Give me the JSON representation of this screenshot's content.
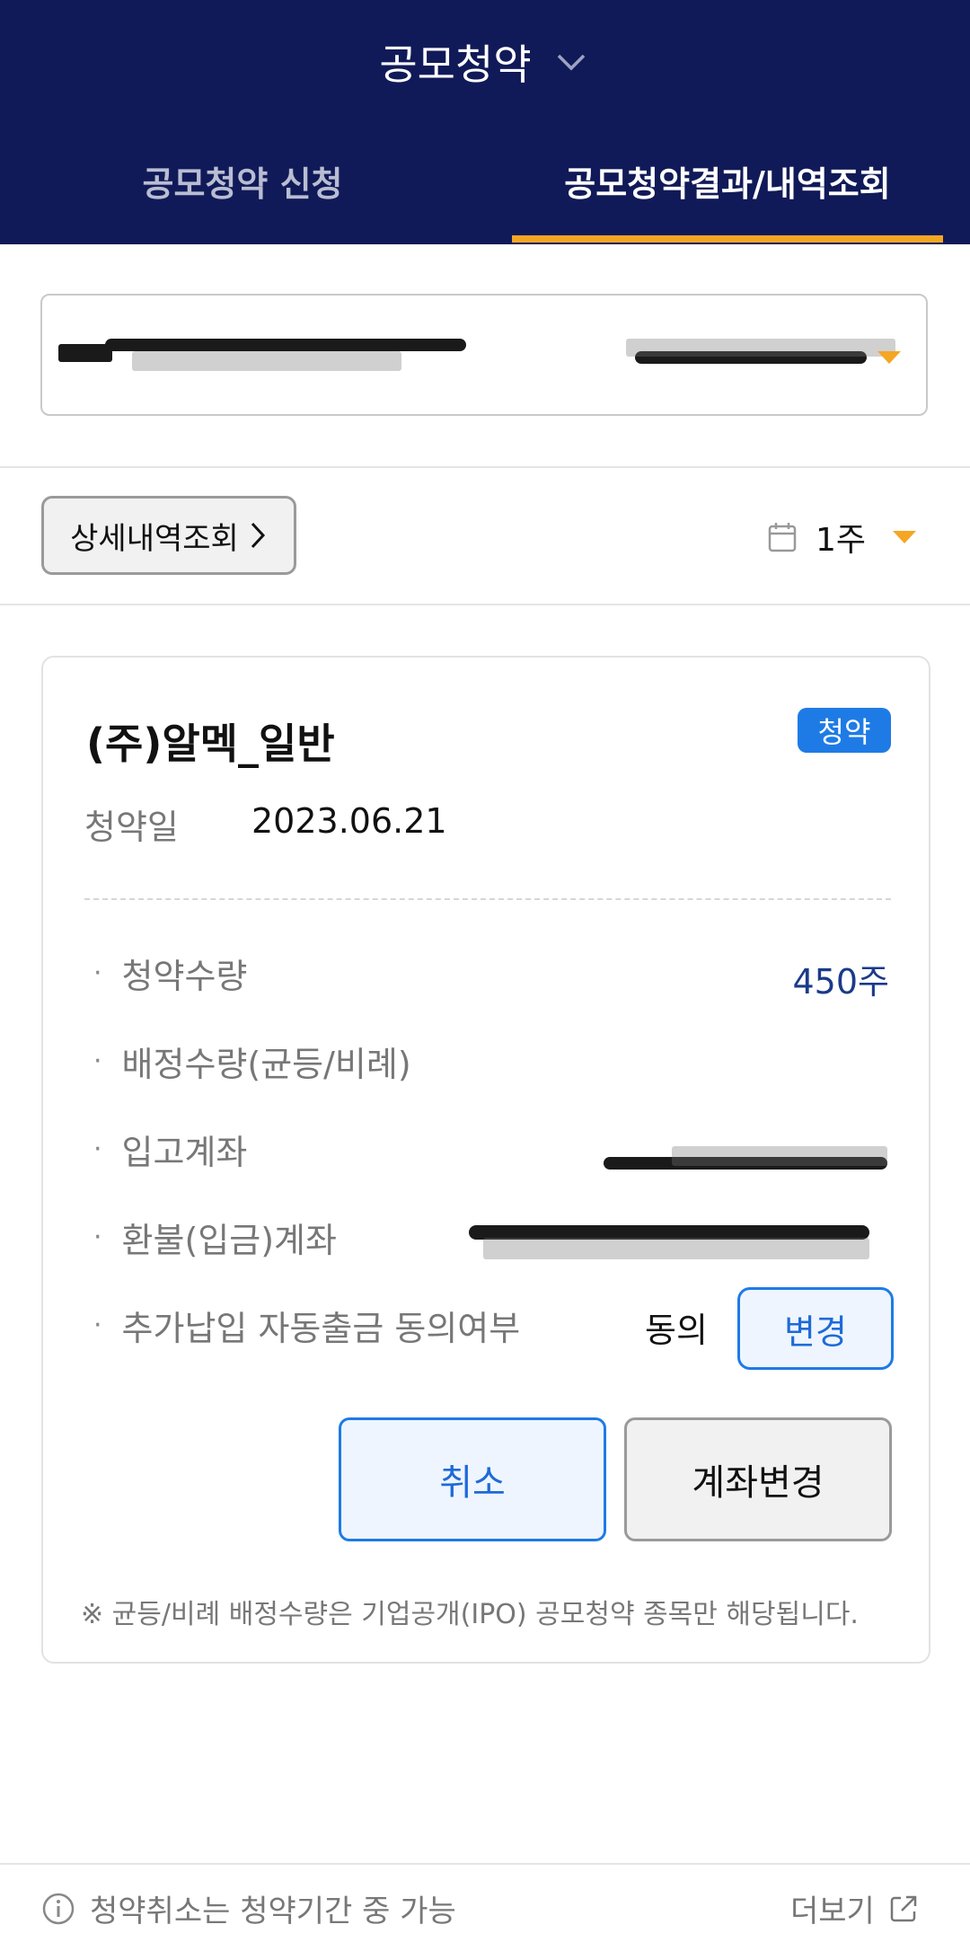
{
  "header": {
    "title": "공모청약",
    "tabs": [
      {
        "label": "공모청약 신청"
      },
      {
        "label": "공모청약결과/내역조회"
      }
    ]
  },
  "filters": {
    "detail_button": "상세내역조회",
    "period": "1주"
  },
  "card": {
    "title": "(주)알멕_일반",
    "badge": "청약",
    "date_label": "청약일",
    "date_value": "2023.06.21",
    "rows": [
      {
        "label": "청약수량",
        "value": "450주"
      },
      {
        "label": "배정수량(균등/비례)"
      },
      {
        "label": "입고계좌"
      },
      {
        "label": "환불(입금)계좌"
      },
      {
        "label": "추가납입 자동출금 동의여부",
        "value": "동의"
      }
    ],
    "change_button": "변경",
    "cancel_button": "취소",
    "account_change_button": "계좌변경",
    "note": "※ 균등/비례 배정수량은 기업공개(IPO) 공모청약 종목만 해당됩니다."
  },
  "footer": {
    "info": "청약취소는 청약기간 중 가능",
    "more": "더보기"
  },
  "colors": {
    "header_bg": "#111a58",
    "tab_indicator": "#f5a623",
    "accent_blue": "#1e7be6",
    "quantity_text": "#1b3a8a"
  },
  "icons": [
    "chevron-down-icon",
    "chevron-right-icon",
    "calendar-icon",
    "caret-down-icon",
    "info-icon",
    "external-link-icon"
  ]
}
